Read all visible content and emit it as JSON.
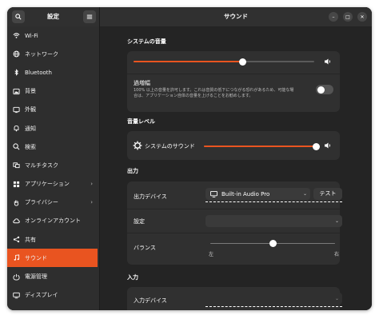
{
  "sidebar": {
    "title": "設定",
    "items": [
      {
        "label": "Wi-Fi",
        "icon": "wifi-icon",
        "has_submenu": false,
        "active": false
      },
      {
        "label": "ネットワーク",
        "icon": "network-icon",
        "has_submenu": false,
        "active": false
      },
      {
        "label": "Bluetooth",
        "icon": "bluetooth-icon",
        "has_submenu": false,
        "active": false
      },
      {
        "label": "背景",
        "icon": "background-icon",
        "has_submenu": false,
        "active": false
      },
      {
        "label": "外観",
        "icon": "appearance-icon",
        "has_submenu": false,
        "active": false
      },
      {
        "label": "通知",
        "icon": "bell-icon",
        "has_submenu": false,
        "active": false
      },
      {
        "label": "検索",
        "icon": "search-icon",
        "has_submenu": false,
        "active": false
      },
      {
        "label": "マルチタスク",
        "icon": "multitasking-icon",
        "has_submenu": false,
        "active": false
      },
      {
        "label": "アプリケーション",
        "icon": "apps-icon",
        "has_submenu": true,
        "active": false
      },
      {
        "label": "プライバシー",
        "icon": "hand-icon",
        "has_submenu": true,
        "active": false
      },
      {
        "label": "オンラインアカウント",
        "icon": "cloud-icon",
        "has_submenu": false,
        "active": false
      },
      {
        "label": "共有",
        "icon": "share-icon",
        "has_submenu": false,
        "active": false
      },
      {
        "label": "サウンド",
        "icon": "music-note-icon",
        "has_submenu": false,
        "active": true
      },
      {
        "label": "電源管理",
        "icon": "power-icon",
        "has_submenu": false,
        "active": false
      },
      {
        "label": "ディスプレイ",
        "icon": "display-icon",
        "has_submenu": false,
        "active": false
      }
    ]
  },
  "main": {
    "title": "サウンド",
    "system_volume": {
      "section_title": "システムの音量",
      "volume_level": 0.6,
      "overamp_label": "過増幅",
      "overamp_hint_line1": "100% 以上の音量を許可します。これは音質の低下につながる恐れがあるため、可能な場",
      "overamp_hint_line2": "合は、アプリケーション自体の音量を上げることをお勧めします。",
      "overamp_enabled": false
    },
    "volume_levels": {
      "section_title": "音量レベル",
      "system_sounds_label": "システムのサウンド",
      "system_sounds_level": 1.0
    },
    "output": {
      "section_title": "出力",
      "device_label": "出力デバイス",
      "device_value": "Built-in Audio Pro",
      "test_label": "テスト",
      "config_label": "設定",
      "config_value": "",
      "balance_label": "バランス",
      "balance_level": 0.5,
      "balance_left": "左",
      "balance_right": "右"
    },
    "input": {
      "section_title": "入力",
      "device_label": "入力デバイス",
      "device_value": ""
    }
  },
  "colors": {
    "accent": "#e95420",
    "window_bg": "#242424",
    "card_bg": "#303030",
    "sidebar_bg": "#2e2e2e"
  }
}
